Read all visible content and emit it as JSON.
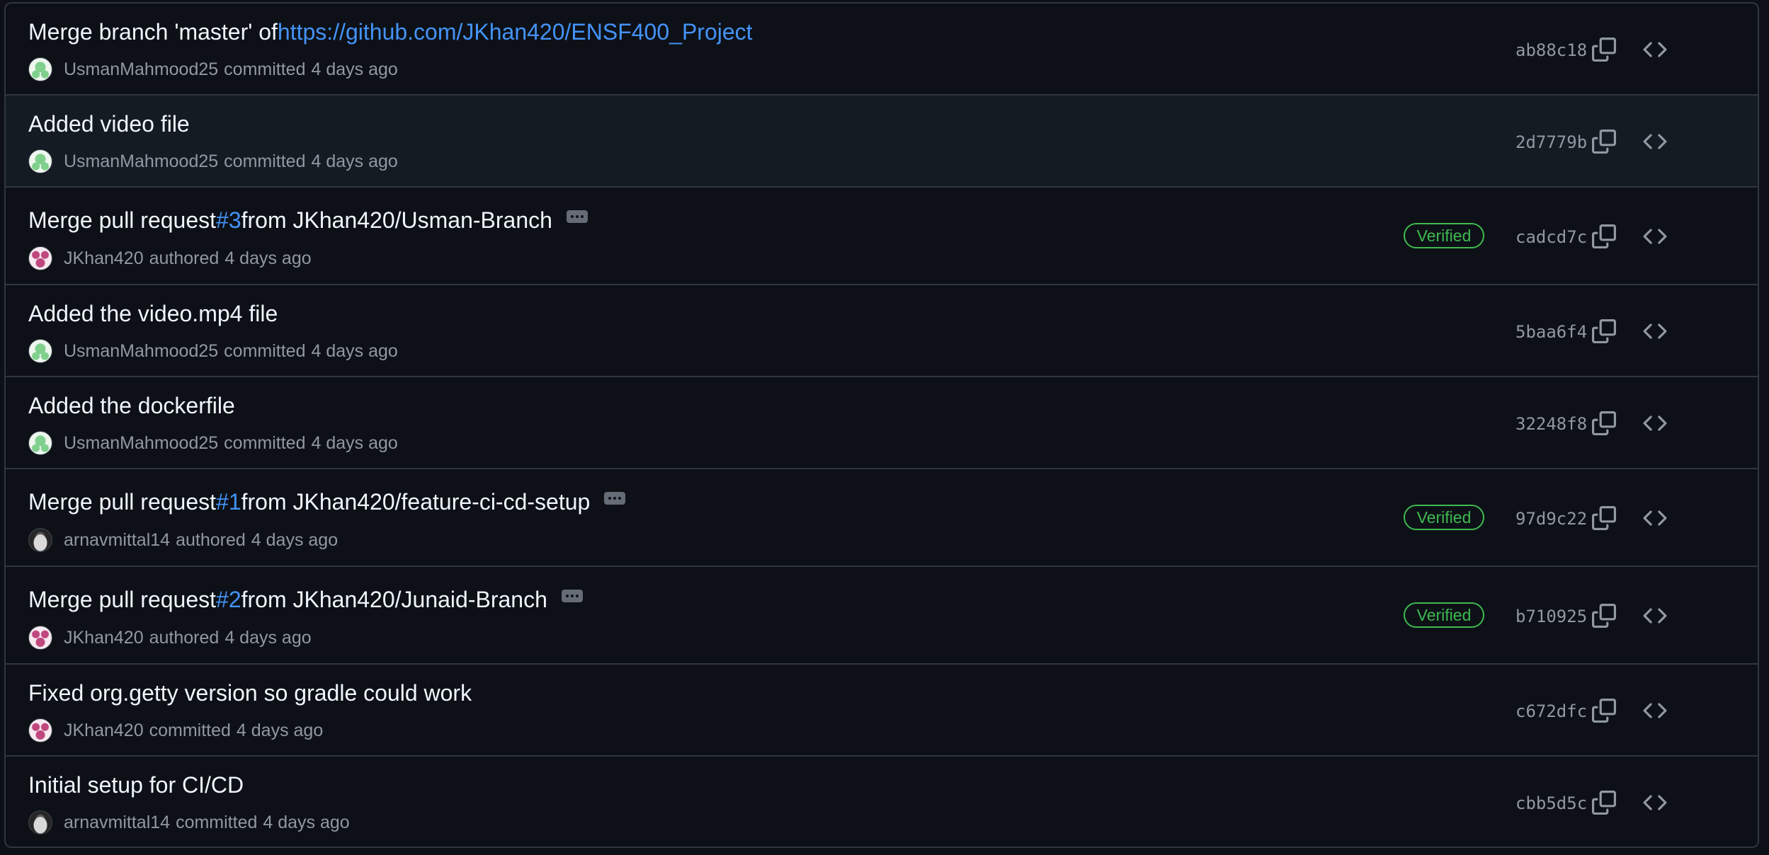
{
  "commits": [
    {
      "title_prefix": "Merge branch 'master' of ",
      "title_link": "https://github.com/JKhan420/ENSF400_Project",
      "title_suffix": "",
      "has_ellipsis": false,
      "avatar": "avatar-usman",
      "author": "UsmanMahmood25",
      "action": "committed",
      "time": "4 days ago",
      "verified": "",
      "sha": "ab88c18"
    },
    {
      "title_prefix": "Added video file",
      "title_link": "",
      "title_suffix": "",
      "has_ellipsis": false,
      "avatar": "avatar-usman",
      "author": "UsmanMahmood25",
      "action": "committed",
      "time": "4 days ago",
      "verified": "",
      "sha": "2d7779b"
    },
    {
      "title_prefix": "Merge pull request ",
      "title_link": "#3",
      "title_suffix": " from JKhan420/Usman-Branch",
      "has_ellipsis": true,
      "avatar": "avatar-jkhan",
      "author": "JKhan420",
      "action": "authored",
      "time": "4 days ago",
      "verified": "Verified",
      "sha": "cadcd7c"
    },
    {
      "title_prefix": "Added the video.mp4 file",
      "title_link": "",
      "title_suffix": "",
      "has_ellipsis": false,
      "avatar": "avatar-usman",
      "author": "UsmanMahmood25",
      "action": "committed",
      "time": "4 days ago",
      "verified": "",
      "sha": "5baa6f4"
    },
    {
      "title_prefix": "Added the dockerfile",
      "title_link": "",
      "title_suffix": "",
      "has_ellipsis": false,
      "avatar": "avatar-usman",
      "author": "UsmanMahmood25",
      "action": "committed",
      "time": "4 days ago",
      "verified": "",
      "sha": "32248f8"
    },
    {
      "title_prefix": "Merge pull request ",
      "title_link": "#1",
      "title_suffix": " from JKhan420/feature-ci-cd-setup",
      "has_ellipsis": true,
      "avatar": "avatar-arnav",
      "author": "arnavmittal14",
      "action": "authored",
      "time": "4 days ago",
      "verified": "Verified",
      "sha": "97d9c22"
    },
    {
      "title_prefix": "Merge pull request ",
      "title_link": "#2",
      "title_suffix": " from JKhan420/Junaid-Branch",
      "has_ellipsis": true,
      "avatar": "avatar-jkhan",
      "author": "JKhan420",
      "action": "authored",
      "time": "4 days ago",
      "verified": "Verified",
      "sha": "b710925"
    },
    {
      "title_prefix": "Fixed org.getty version so gradle could work",
      "title_link": "",
      "title_suffix": "",
      "has_ellipsis": false,
      "avatar": "avatar-jkhan",
      "author": "JKhan420",
      "action": "committed",
      "time": "4 days ago",
      "verified": "",
      "sha": "c672dfc"
    },
    {
      "title_prefix": "Initial setup for CI/CD",
      "title_link": "",
      "title_suffix": "",
      "has_ellipsis": false,
      "avatar": "avatar-arnav",
      "author": "arnavmittal14",
      "action": "committed",
      "time": "4 days ago",
      "verified": "",
      "sha": "cbb5d5c"
    }
  ],
  "icons": {
    "copy": "copy-icon",
    "code": "code-icon",
    "more": "ellipsis-icon"
  },
  "colors": {
    "background": "#0d1117",
    "border": "#30363d",
    "link": "#4493f8",
    "verified": "#3fb950",
    "muted": "#9198a1"
  }
}
